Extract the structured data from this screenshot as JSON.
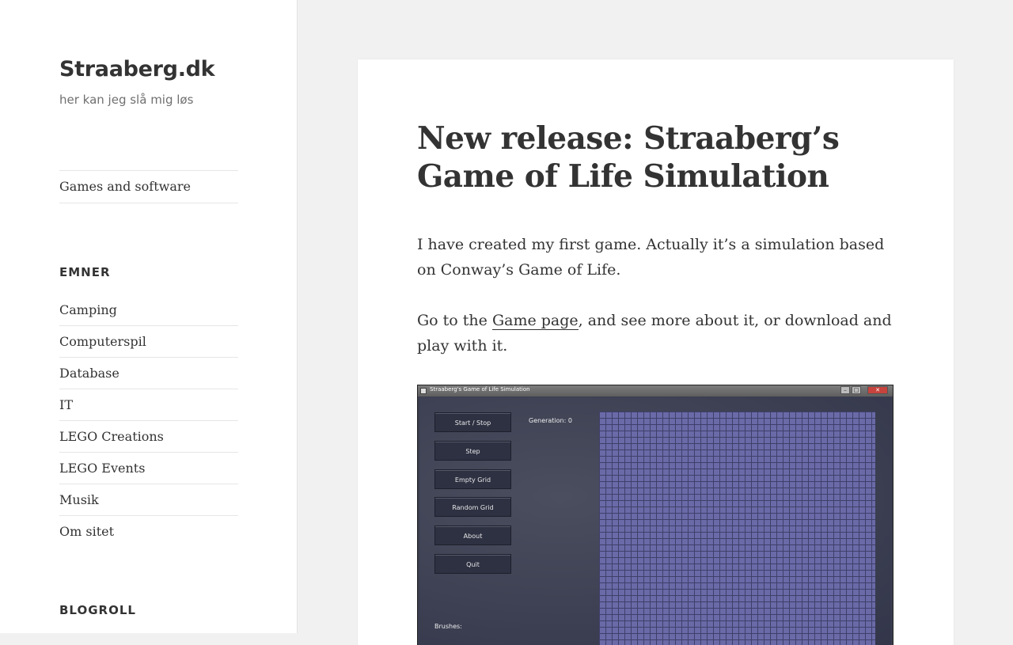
{
  "site": {
    "title": "Straaberg.dk",
    "description": "her kan jeg slå mig løs"
  },
  "menu": {
    "items": [
      "Games and software"
    ]
  },
  "widgets": {
    "categories": {
      "title": "EMNER",
      "items": [
        "Camping",
        "Computerspil",
        "Database",
        "IT",
        "LEGO Creations",
        "LEGO Events",
        "Musik",
        "Om sitet"
      ]
    },
    "blogroll": {
      "title": "BLOGROLL"
    }
  },
  "post": {
    "title": "New release: Straaberg’s Game of Life Simulation",
    "paragraph1": "I have created my first game. Actually it’s a simulation based on Conway’s Game of Life.",
    "paragraph2_before": "Go to the ",
    "paragraph2_link": "Game page",
    "paragraph2_after": ", and see more about it, or download and play with it."
  },
  "game_screenshot": {
    "window_title": "Straaberg's Game of Life Simulation",
    "buttons": [
      "Start / Stop",
      "Step",
      "Empty Grid",
      "Random Grid",
      "About",
      "Quit"
    ],
    "generation_label": "Generation: 0",
    "brushes_label": "Brushes:",
    "window_controls": [
      "–",
      "□",
      "✕"
    ]
  },
  "colors": {
    "background": "#f1f1f1",
    "sidebar": "#ffffff",
    "text": "#333333",
    "grid_cell": "#6a6aa8"
  }
}
